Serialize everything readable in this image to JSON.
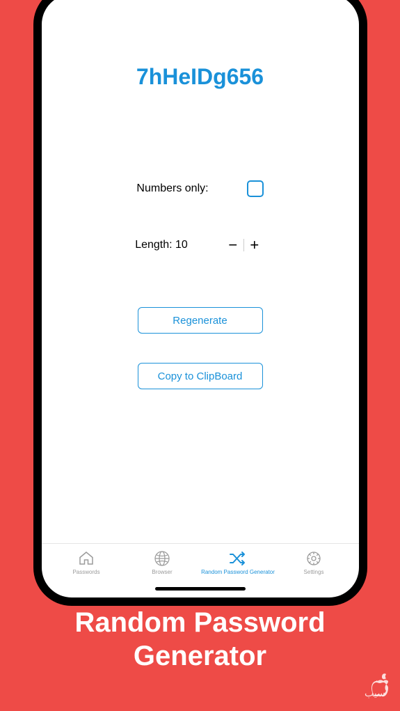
{
  "password": "7hHeIDg656",
  "options": {
    "numbersOnlyLabel": "Numbers only:",
    "numbersOnlyChecked": false,
    "lengthLabel": "Length: 10",
    "lengthValue": 10
  },
  "buttons": {
    "regenerate": "Regenerate",
    "copy": "Copy to ClipBoard"
  },
  "tabs": [
    {
      "label": "Passwords",
      "active": false
    },
    {
      "label": "Browser",
      "active": false
    },
    {
      "label": "Random Password Generator",
      "active": true
    },
    {
      "label": "Settings",
      "active": false
    }
  ],
  "promo": {
    "titleLine1": "Random Password",
    "titleLine2": "Generator"
  }
}
